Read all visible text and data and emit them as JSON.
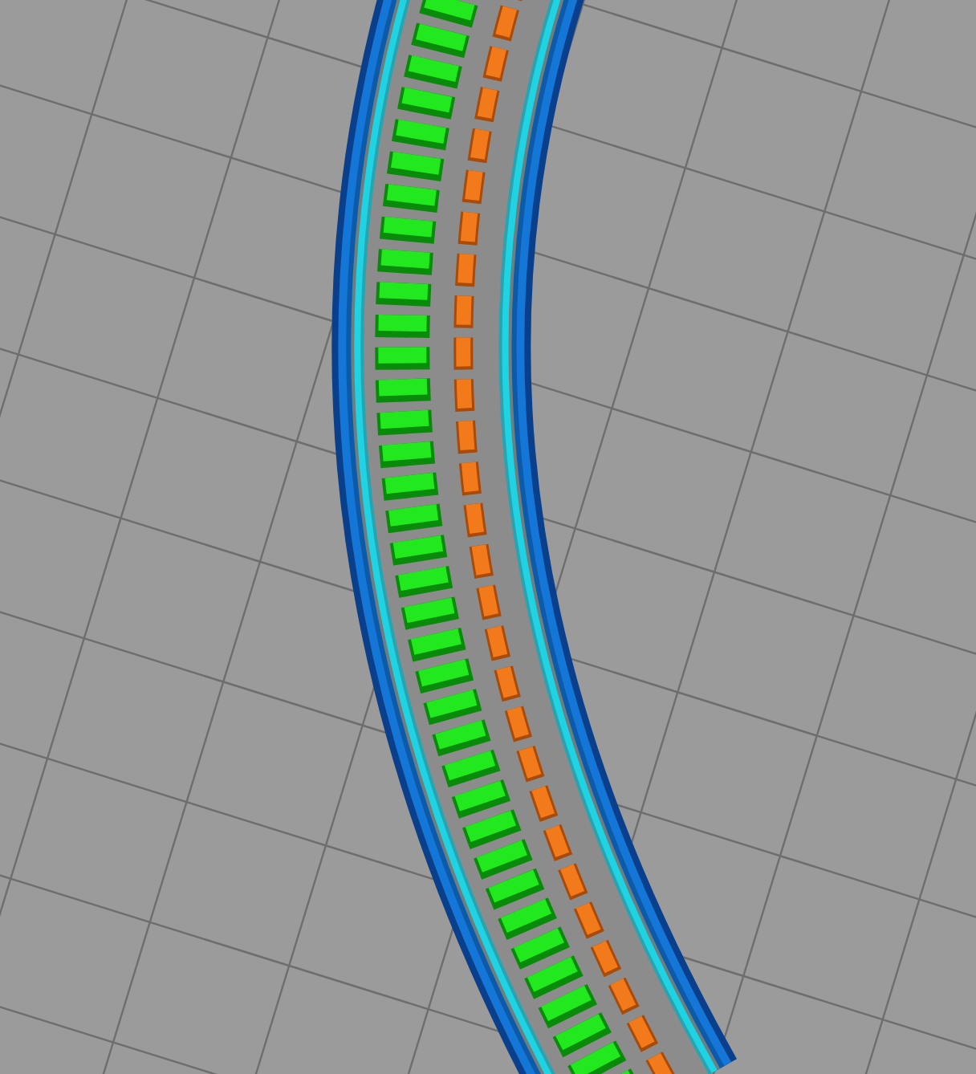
{
  "view": {
    "kind": "toolpath-preview"
  }
}
